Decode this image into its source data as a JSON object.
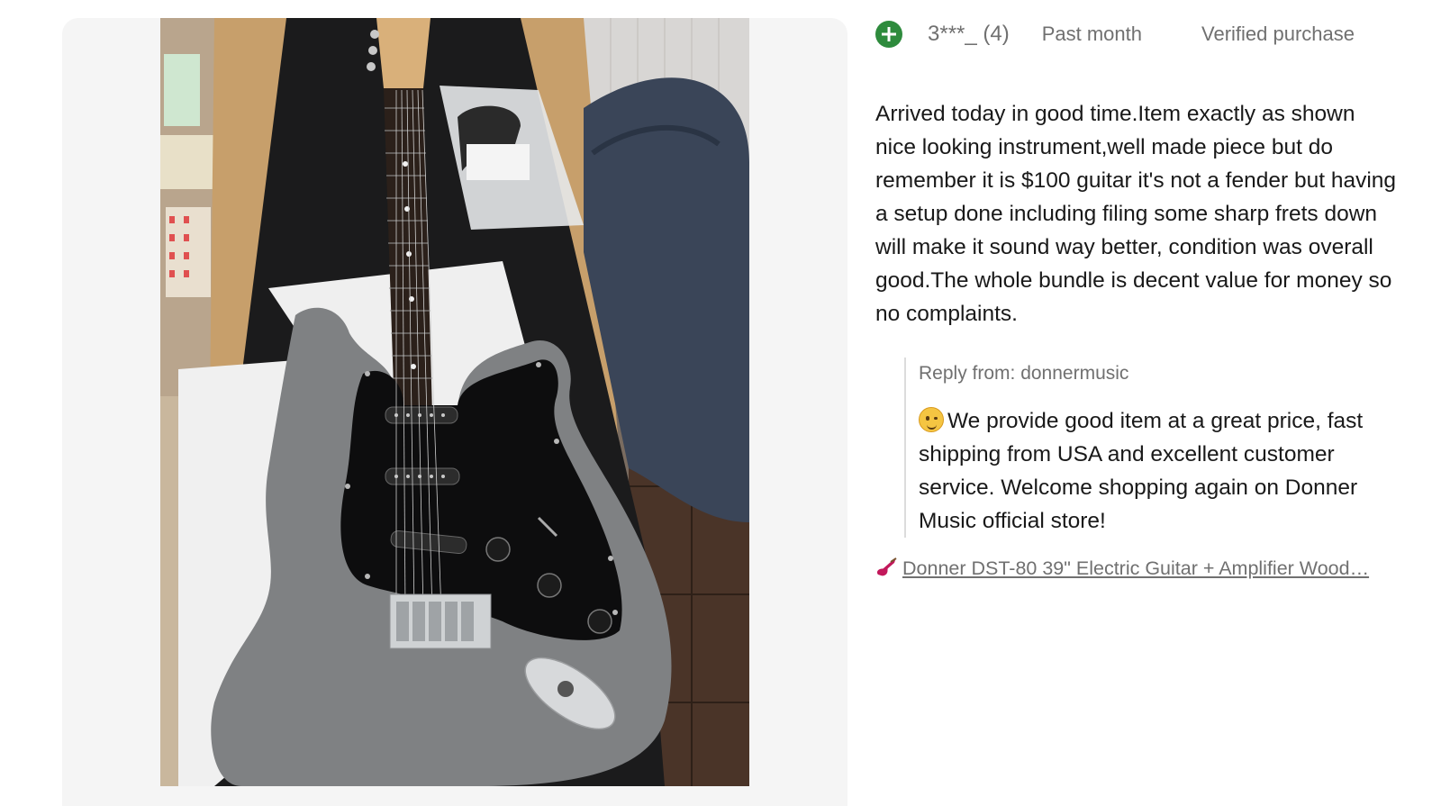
{
  "review": {
    "reviewer": "3***_ (4)",
    "date": "Past month",
    "verified": "Verified purchase",
    "text": "Arrived today in good time.Item exactly as shown nice looking instrument,well made piece but do remember it is $100 guitar it's not a fender but having a setup done including filing some sharp frets down will make it sound way better, condition was overall good.The whole bundle is decent value for money so no complaints.",
    "reply": {
      "from": "Reply from: donnermusic",
      "text": "We provide good item at a great price, fast shipping from USA and excellent customer service. Welcome shopping again on Donner Music official store!"
    },
    "product_link": "Donner DST-80 39\" Electric Guitar + Amplifier Wood…"
  },
  "icons": {
    "avatar": "plus-circle-icon",
    "emoji": "smiling-face-icon",
    "product": "electric-guitar-icon"
  },
  "colors": {
    "avatar_green": "#2e8b3d",
    "muted_text": "#707070",
    "body_text": "#191919",
    "panel_bg": "#f5f5f5",
    "guitar_icon_pink": "#c2185b"
  }
}
